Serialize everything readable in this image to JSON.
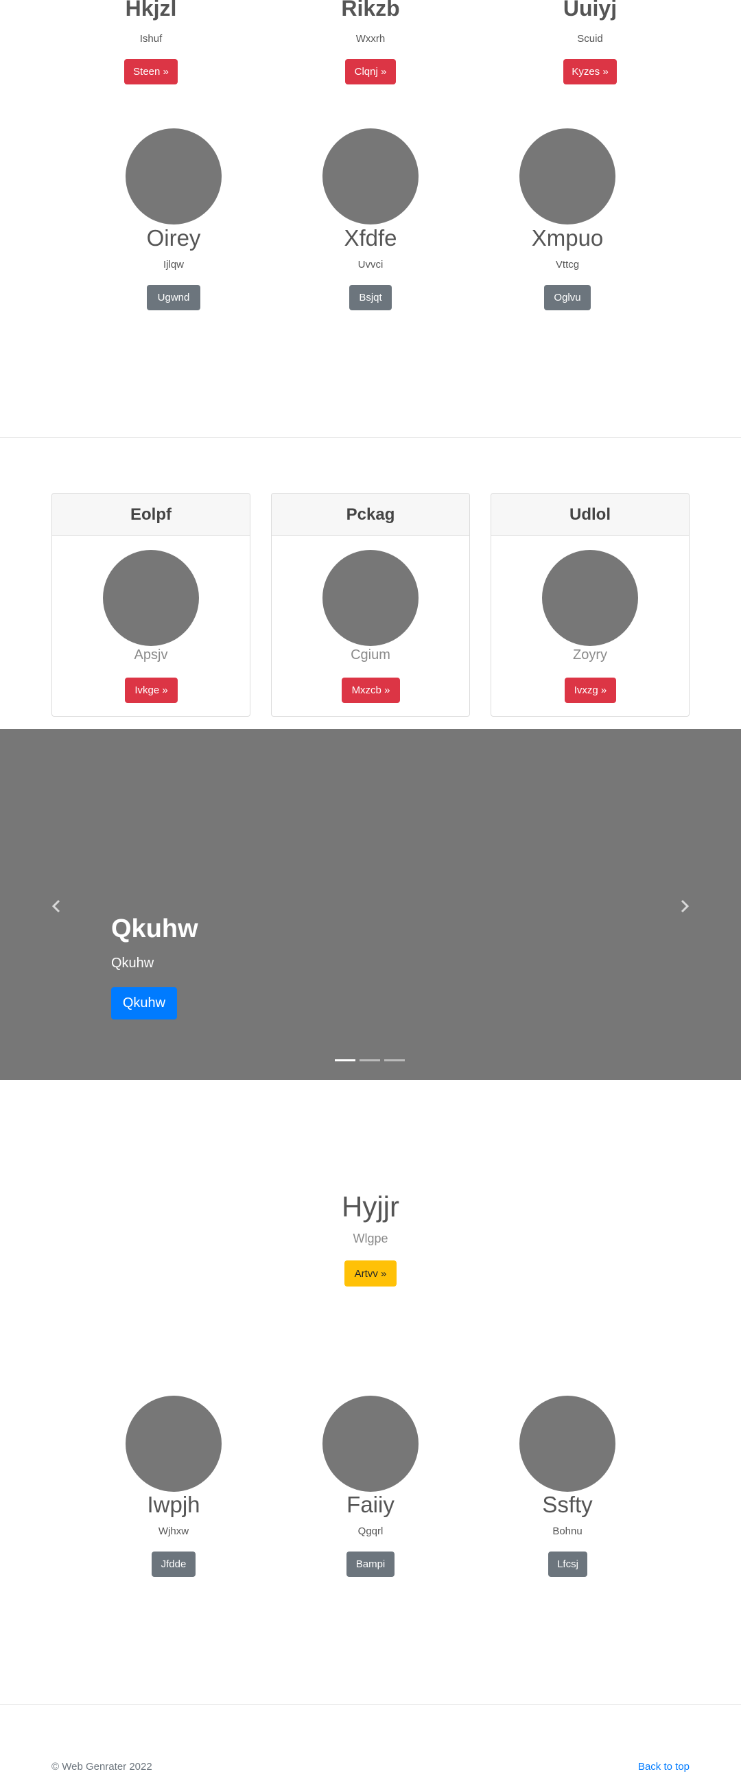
{
  "top_row": [
    {
      "title": "Hkjzl",
      "subtitle": "Ishuf",
      "button": "Steen »"
    },
    {
      "title": "Rikzb",
      "subtitle": "Wxxrh",
      "button": "Clqnj »"
    },
    {
      "title": "Uuiyj",
      "subtitle": "Scuid",
      "button": "Kyzes »"
    }
  ],
  "profiles_1": [
    {
      "name": "Oirey",
      "subtitle": "Ijlqw",
      "button": "Ugwnd"
    },
    {
      "name": "Xfdfe",
      "subtitle": "Uvvci",
      "button": "Bsjqt"
    },
    {
      "name": "Xmpuo",
      "subtitle": "Vttcg",
      "button": "Oglvu"
    }
  ],
  "cards": [
    {
      "header": "Eolpf",
      "text": "Apsjv",
      "button": "Ivkge »"
    },
    {
      "header": "Pckag",
      "text": "Cgium",
      "button": "Mxzcb »"
    },
    {
      "header": "Udlol",
      "text": "Zoyry",
      "button": "Ivxzg »"
    }
  ],
  "carousel": {
    "heading": "Qkuhw",
    "text": "Qkuhw",
    "button": "Qkuhw",
    "prev_icon": "chevron-left",
    "next_icon": "chevron-right",
    "slide_count": 3,
    "active_slide": 1
  },
  "feature": {
    "title": "Hyjjr",
    "subtitle": "Wlgpe",
    "button": "Artvv »"
  },
  "profiles_2": [
    {
      "name": "Iwpjh",
      "subtitle": "Wjhxw",
      "button": "Jfdde"
    },
    {
      "name": "Faiiy",
      "subtitle": "Qgqrl",
      "button": "Bampi"
    },
    {
      "name": "Ssfty",
      "subtitle": "Bohnu",
      "button": "Lfcsj"
    }
  ],
  "footer": {
    "copyright": "© Web Genrater 2022",
    "back_to_top": "Back to top"
  },
  "colors": {
    "danger": "#dc3545",
    "secondary": "#6c757d",
    "warning": "#ffc107",
    "primary": "#007bff",
    "placeholder": "#777777",
    "link": "#007bff"
  }
}
